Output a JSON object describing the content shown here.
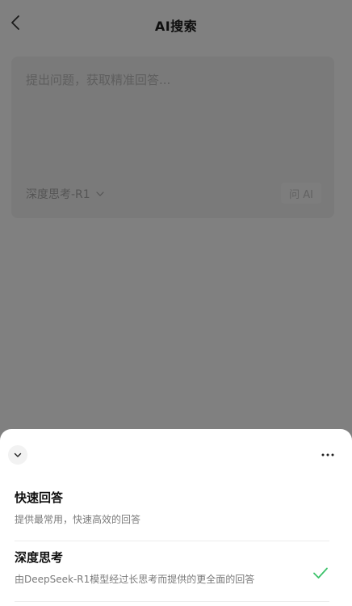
{
  "header": {
    "title": "AI搜索"
  },
  "search_card": {
    "placeholder": "提出问题，获取精准回答...",
    "mode_label": "深度思考-R1",
    "ask_button_label": "问 AI"
  },
  "sheet": {
    "options": [
      {
        "title": "快速回答",
        "description": "提供最常用，快速高效的回答",
        "selected": false
      },
      {
        "title": "深度思考",
        "description": "由DeepSeek-R1模型经过长思考而提供的更全面的回答",
        "selected": true
      }
    ]
  },
  "colors": {
    "overlay": "#808080",
    "sheet_bg": "#ffffff",
    "check_green": "#3cc26a"
  }
}
